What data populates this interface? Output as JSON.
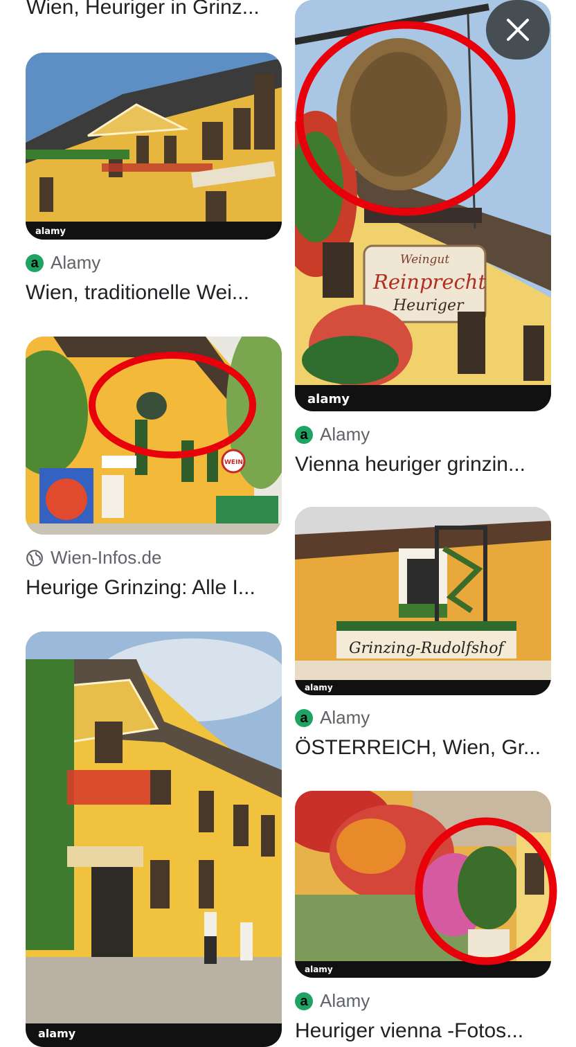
{
  "results": [
    {
      "source": "",
      "title": "Wien, Heuriger in Grinz..."
    },
    {
      "source": "Alamy",
      "title": "Wien, traditionelle Wei..."
    },
    {
      "source": "Wien-Infos.de",
      "title": "Heurige Grinzing: Alle I..."
    },
    {
      "source": "Alamy",
      "title": "Vienna heuriger grinzin..."
    },
    {
      "source": "Alamy",
      "title": "ÖSTERREICH, Wien, Gr..."
    },
    {
      "source": "Alamy",
      "title": "Heuriger vienna -Fotos..."
    }
  ],
  "images": {
    "watermark": "alamy",
    "sign_reinprecht_line1": "Weingut",
    "sign_reinprecht_line2": "Reinprecht",
    "sign_reinprecht_line3": "Heuriger",
    "sign_rudolfshof": "Grinzing-Rudolfshof",
    "sign_wein": "WEIN"
  },
  "icons": {
    "alamy_logo_letter": "a",
    "close": "close-icon",
    "globe": "globe-icon"
  },
  "colors": {
    "highlight_circle": "#e8000b",
    "alamy_green": "#1ea362"
  }
}
